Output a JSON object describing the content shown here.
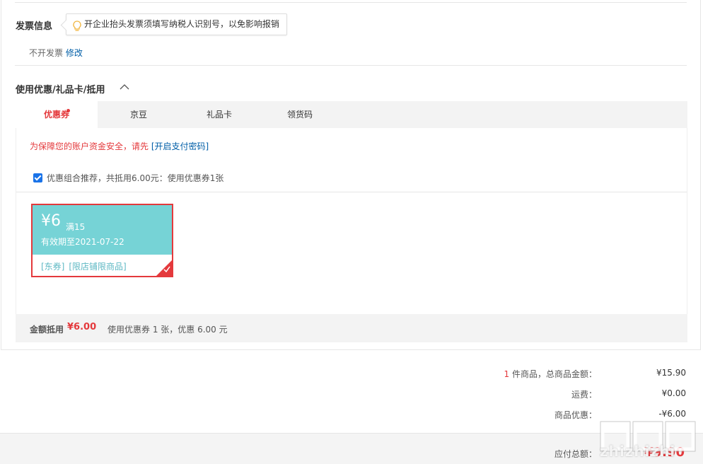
{
  "invoice": {
    "title": "发票信息",
    "tip": "开企业抬头发票须填写纳税人识别号，以免影响报销",
    "status": "不开发票",
    "edit_link": "修改"
  },
  "discount": {
    "title": "使用优惠/礼品卡/抵用",
    "tabs": [
      {
        "label": "优惠券"
      },
      {
        "label": "京豆"
      },
      {
        "label": "礼品卡"
      },
      {
        "label": "领货码"
      }
    ],
    "security_warning": "为保障您的账户资金安全，请先",
    "security_link": "[开启支付密码]",
    "combo_text": "优惠组合推荐，共抵用6.00元：使用优惠券1张",
    "coupon": {
      "amount": "¥6",
      "condition": "满15",
      "validity": "有效期至2021-07-22",
      "tag1": "[东券]",
      "tag2": "[限店铺限商品]"
    },
    "summary": {
      "label": "金额抵用",
      "amount": "¥6.00",
      "desc": "使用优惠券 1 张，优惠 6.00 元"
    }
  },
  "totals": {
    "count": "1",
    "items_label": " 件商品，总商品金额：",
    "items_value": "¥15.90",
    "shipping_label": "运费：",
    "shipping_value": "¥0.00",
    "discount_label": "商品优惠：",
    "discount_value": "-¥6.00",
    "pay_label": "应付总额：",
    "pay_value": "¥9.90"
  },
  "watermark": {
    "text": "zhizhizhi"
  },
  "colors": {
    "accent_red": "#e4393c",
    "link_blue": "#005ea7",
    "coupon_teal": "#76d3d6"
  }
}
